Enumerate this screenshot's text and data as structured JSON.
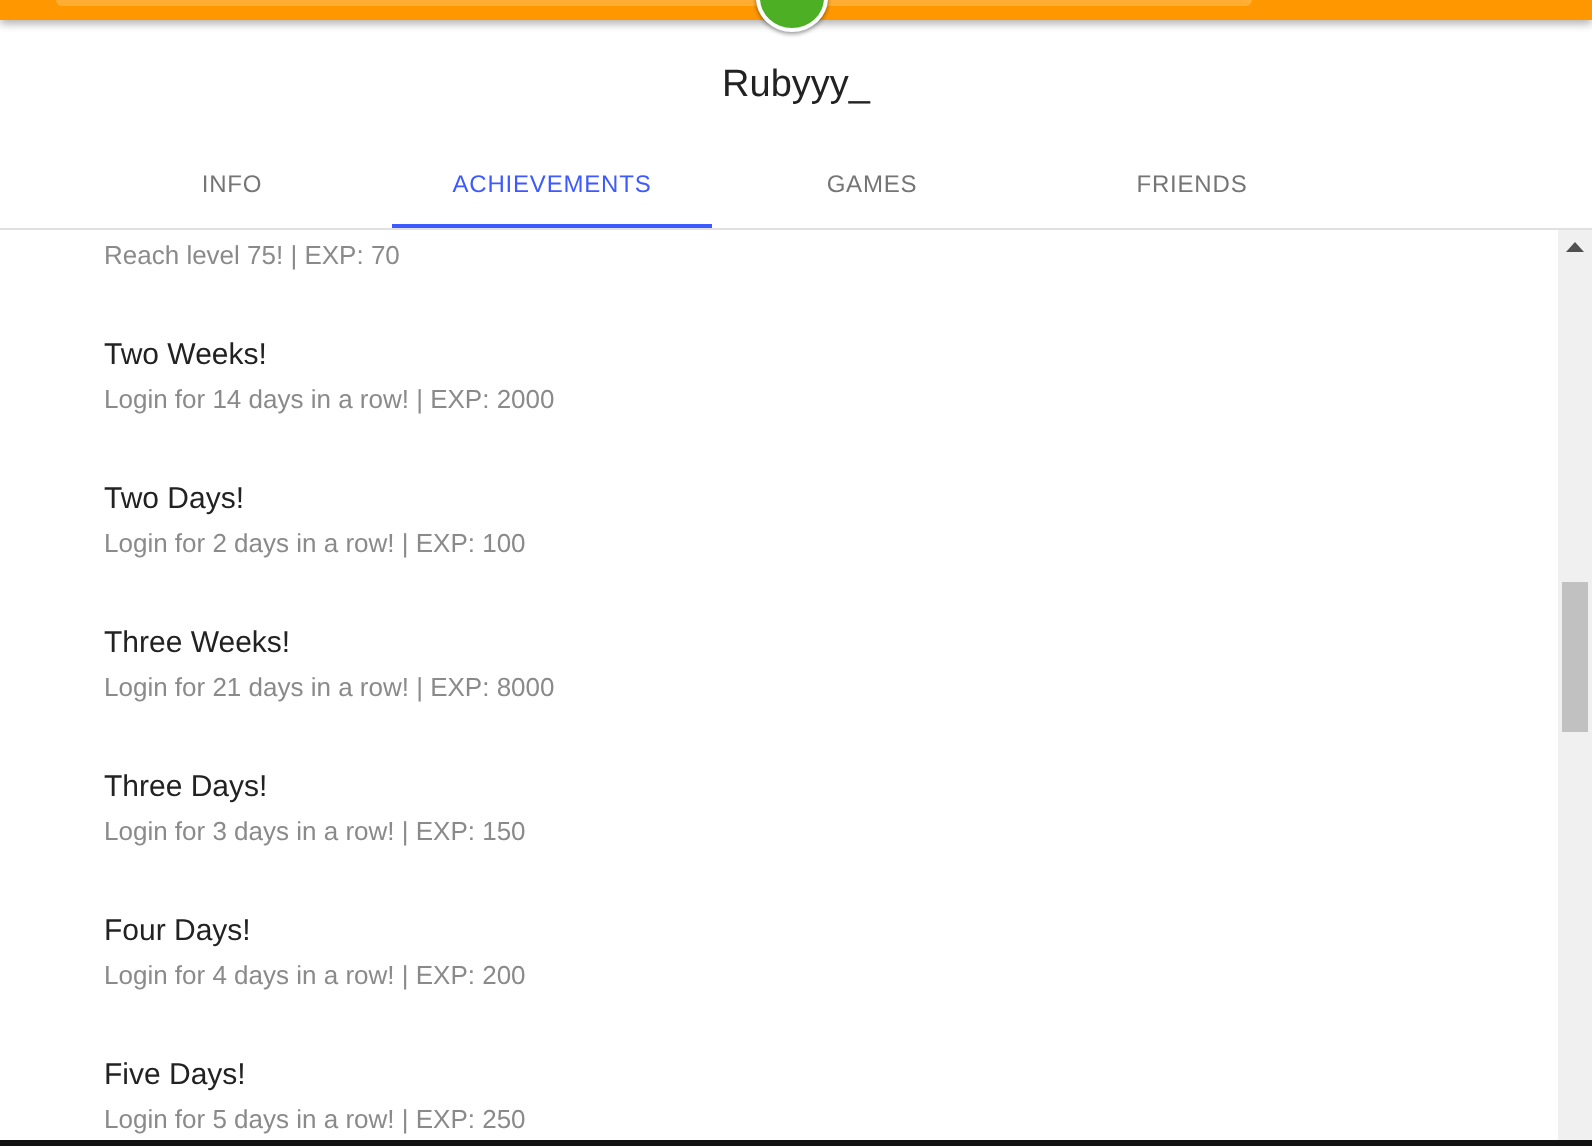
{
  "profile": {
    "username": "Rubyyy_"
  },
  "tabs": [
    {
      "label": "INFO",
      "selected": false
    },
    {
      "label": "ACHIEVEMENTS",
      "selected": true
    },
    {
      "label": "GAMES",
      "selected": false
    },
    {
      "label": "FRIENDS",
      "selected": false
    }
  ],
  "achievements": [
    {
      "description": "Reach level 75! | EXP: 70"
    },
    {
      "title": "Two Weeks!",
      "description": "Login for 14 days in a row! | EXP: 2000"
    },
    {
      "title": "Two Days!",
      "description": "Login for 2 days in a row! | EXP: 100"
    },
    {
      "title": "Three Weeks!",
      "description": "Login for 21 days in a row! | EXP: 8000"
    },
    {
      "title": "Three Days!",
      "description": "Login for 3 days in a row! | EXP: 150"
    },
    {
      "title": "Four Days!",
      "description": "Login for 4 days in a row! | EXP: 200"
    },
    {
      "title": "Five Days!",
      "description": "Login for 5 days in a row! | EXP: 250"
    }
  ]
}
